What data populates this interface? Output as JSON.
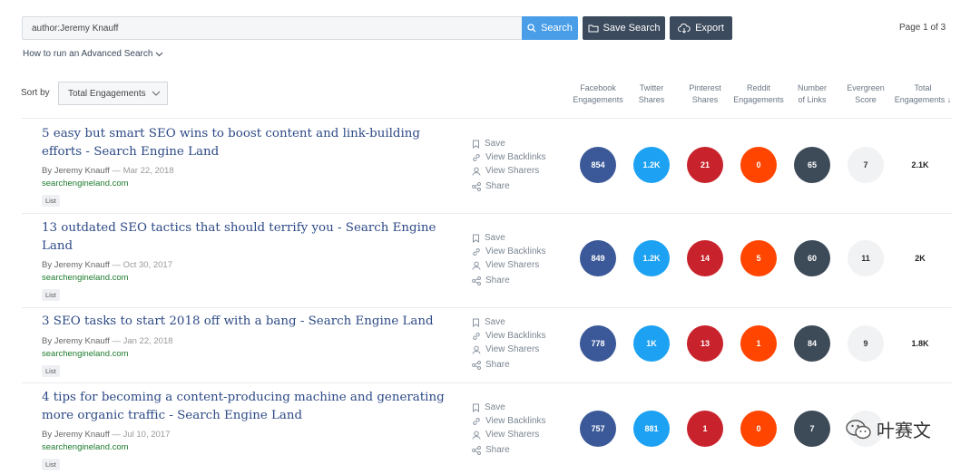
{
  "search": {
    "value": "author:Jeremy Knauff",
    "button_label": "Search"
  },
  "toolbar": {
    "save_search_label": "Save Search",
    "export_label": "Export"
  },
  "pagination": {
    "text": "Page 1 of 3"
  },
  "advanced_link": "How to run an Advanced Search",
  "sort": {
    "label": "Sort by",
    "selected": "Total Engagements"
  },
  "columns": [
    [
      "Facebook",
      "Engagements"
    ],
    [
      "Twitter",
      "Shares"
    ],
    [
      "Pinterest",
      "Shares"
    ],
    [
      "Reddit",
      "Engagements"
    ],
    [
      "Number",
      "of Links"
    ],
    [
      "Evergreen",
      "Score"
    ],
    [
      "Total",
      "Engagements ↓"
    ]
  ],
  "actions": {
    "save": "Save",
    "backlinks": "View Backlinks",
    "sharers": "View Sharers",
    "share": "Share"
  },
  "results": [
    {
      "title": "5 easy but smart SEO wins to boost content and link-building efforts - Search Engine Land",
      "author": "By Jeremy Knauff",
      "date": "— Mar 22, 2018",
      "domain": "searchengineland.com",
      "tag": "List",
      "facebook": "854",
      "twitter": "1.2K",
      "pinterest": "21",
      "reddit": "0",
      "links": "65",
      "evergreen": "7",
      "total": "2.1K"
    },
    {
      "title": "13 outdated SEO tactics that should terrify you - Search Engine Land",
      "author": "By Jeremy Knauff",
      "date": "— Oct 30, 2017",
      "domain": "searchengineland.com",
      "tag": "List",
      "facebook": "849",
      "twitter": "1.2K",
      "pinterest": "14",
      "reddit": "5",
      "links": "60",
      "evergreen": "11",
      "total": "2K"
    },
    {
      "title": "3 SEO tasks to start 2018 off with a bang - Search Engine Land",
      "author": "By Jeremy Knauff",
      "date": "— Jan 22, 2018",
      "domain": "searchengineland.com",
      "tag": "List",
      "facebook": "778",
      "twitter": "1K",
      "pinterest": "13",
      "reddit": "1",
      "links": "84",
      "evergreen": "9",
      "total": "1.8K"
    },
    {
      "title": "4 tips for becoming a content-producing machine and generating more organic traffic - Search Engine Land",
      "author": "By Jeremy Knauff",
      "date": "— Jul 10, 2017",
      "domain": "searchengineland.com",
      "tag": "List",
      "facebook": "757",
      "twitter": "881",
      "pinterest": "1",
      "reddit": "0",
      "links": "7",
      "evergreen": "",
      "total": ""
    }
  ],
  "watermark": "叶赛文",
  "colors": {
    "search_button": "#4a9ee8",
    "dark_button": "#3b4a5c",
    "facebook": "#3b5998",
    "twitter": "#1da1f2",
    "pinterest": "#c8232c",
    "reddit": "#ff4500",
    "links": "#3d4a58",
    "evergreen": "#f1f2f3",
    "title_link": "#2d4a86",
    "domain": "#1e7c2e"
  },
  "icons": {
    "search": "search-icon",
    "save_search": "folder-icon",
    "export": "cloud-download-icon",
    "save": "bookmark-icon",
    "backlinks": "link-icon",
    "sharers": "user-icon",
    "share": "share-icon",
    "watermark": "wechat-icon"
  }
}
